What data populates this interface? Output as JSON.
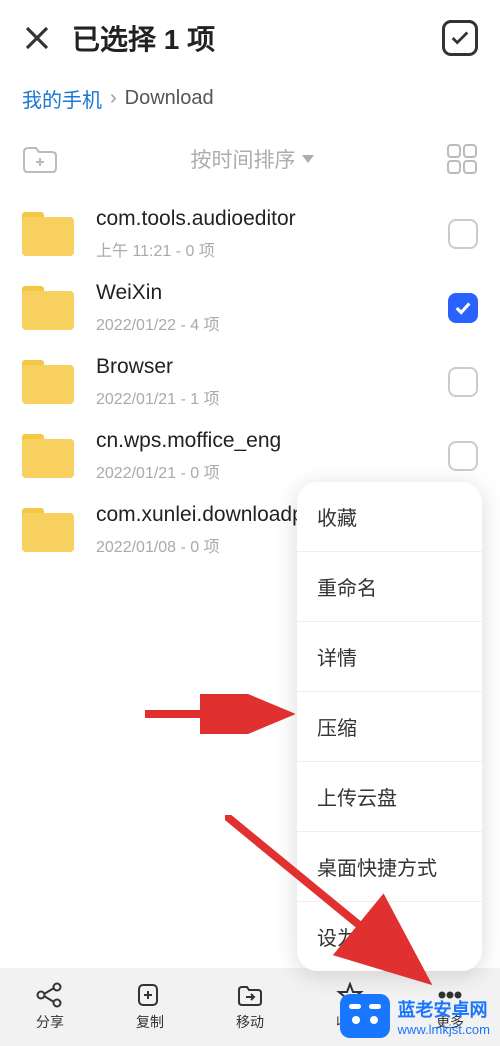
{
  "header": {
    "title": "已选择 1 项"
  },
  "breadcrumb": {
    "root": "我的手机",
    "current": "Download"
  },
  "sort": {
    "label": "按时间排序"
  },
  "files": [
    {
      "name": "com.tools.audioeditor",
      "meta": "上午 11:21  - 0 项",
      "checked": false
    },
    {
      "name": "WeiXin",
      "meta": "2022/01/22 - 4 项",
      "checked": true
    },
    {
      "name": "Browser",
      "meta": "2022/01/21 - 1 项",
      "checked": false
    },
    {
      "name": "cn.wps.moffice_eng",
      "meta": "2022/01/21 - 0 项",
      "checked": false
    },
    {
      "name": "com.xunlei.downloadprovider",
      "meta": "2022/01/08 - 0 项",
      "checked": false
    }
  ],
  "menu": {
    "items": [
      "收藏",
      "重命名",
      "详情",
      "压缩",
      "上传云盘",
      "桌面快捷方式",
      "设为来源"
    ]
  },
  "bottom": {
    "share": "分享",
    "copy": "复制",
    "move": "移动",
    "favorite": "收藏",
    "more": "更多"
  },
  "watermark": {
    "title": "蓝老安卓网",
    "url": "www.lmkjst.com"
  }
}
